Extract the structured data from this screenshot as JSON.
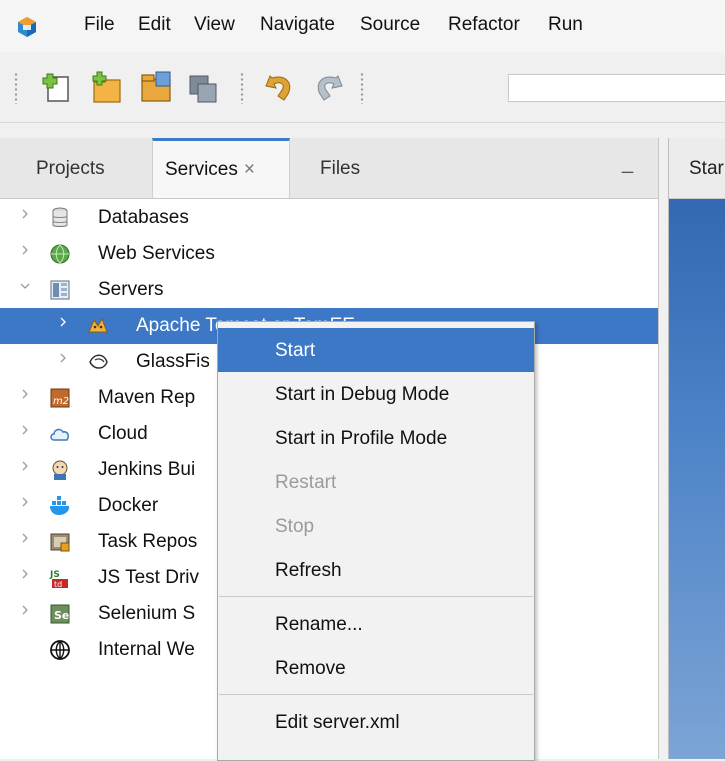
{
  "menubar": {
    "items": [
      "File",
      "Edit",
      "View",
      "Navigate",
      "Source",
      "Refactor",
      "Run"
    ]
  },
  "toolbar": {
    "buttons": [
      {
        "icon": "new-file-icon"
      },
      {
        "icon": "new-project-icon"
      },
      {
        "icon": "open-project-icon"
      },
      {
        "icon": "save-all-icon"
      },
      {
        "icon": "undo-icon"
      },
      {
        "icon": "redo-icon"
      }
    ]
  },
  "panel": {
    "tabs": [
      {
        "label": "Projects"
      },
      {
        "label": "Services",
        "close": "×"
      },
      {
        "label": "Files"
      }
    ],
    "minimize": "_"
  },
  "tree": {
    "nodes": [
      {
        "label": "Databases",
        "icon": "database-icon",
        "expander": "collapsed"
      },
      {
        "label": "Web Services",
        "icon": "web-services-icon",
        "expander": "collapsed"
      },
      {
        "label": "Servers",
        "icon": "servers-icon",
        "expander": "expanded"
      },
      {
        "label": "Apache Tomcat or TomEE",
        "icon": "tomcat-icon",
        "expander": "collapsed",
        "selected": true
      },
      {
        "label": "GlassFis",
        "icon": "glassfish-icon",
        "expander": "collapsed"
      },
      {
        "label": "Maven Rep",
        "icon": "maven-icon",
        "expander": "collapsed"
      },
      {
        "label": "Cloud",
        "icon": "cloud-icon",
        "expander": "collapsed"
      },
      {
        "label": "Jenkins Bui",
        "icon": "jenkins-icon",
        "expander": "collapsed"
      },
      {
        "label": "Docker",
        "icon": "docker-icon",
        "expander": "collapsed"
      },
      {
        "label": "Task Repos",
        "icon": "task-repository-icon",
        "expander": "collapsed"
      },
      {
        "label": "JS Test Driv",
        "icon": "js-test-driver-icon",
        "expander": "collapsed"
      },
      {
        "label": "Selenium S",
        "icon": "selenium-icon",
        "expander": "collapsed"
      },
      {
        "label": "Internal We",
        "icon": "globe-icon",
        "expander": "none"
      }
    ]
  },
  "editor": {
    "tab_label": "Star"
  },
  "context_menu": {
    "items": [
      {
        "label": "Start",
        "highlighted": true,
        "enabled": true
      },
      {
        "label": "Start in Debug Mode",
        "enabled": true
      },
      {
        "label": "Start in Profile Mode",
        "enabled": true
      },
      {
        "label": "Restart",
        "enabled": false
      },
      {
        "label": "Stop",
        "enabled": false
      },
      {
        "label": "Refresh",
        "enabled": true
      },
      {
        "separator": true
      },
      {
        "label": "Rename...",
        "enabled": true
      },
      {
        "label": "Remove",
        "enabled": true
      },
      {
        "separator": true
      },
      {
        "label": "Edit server.xml",
        "enabled": true
      }
    ]
  },
  "colors": {
    "selection": "#3c78c6",
    "accent_tab": "#3d7bc8"
  }
}
